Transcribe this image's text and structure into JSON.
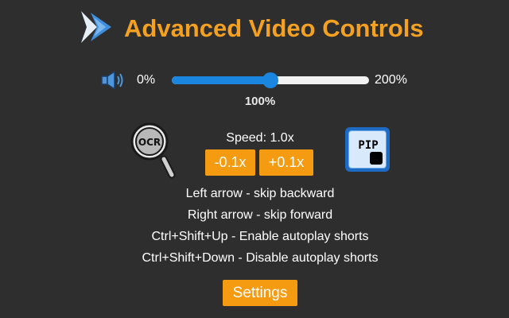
{
  "header": {
    "title": "Advanced Video Controls",
    "logo_icon": "double-chevron-logo-icon",
    "title_color": "#f4a021"
  },
  "volume": {
    "icon": "speaker-icon",
    "min_label": "0%",
    "max_label": "200%",
    "current_label": "100%",
    "value_fraction": 0.5,
    "accent_color": "#1a86e0"
  },
  "ocr": {
    "icon": "ocr-magnifier-icon",
    "label": "OCR"
  },
  "speed": {
    "label": "Speed: 1.0x",
    "decrease_label": "-0.1x",
    "increase_label": "+0.1x"
  },
  "pip": {
    "icon": "pip-icon",
    "label": "PIP"
  },
  "shortcuts": [
    "Left arrow - skip backward",
    "Right arrow - skip forward",
    "Ctrl+Shift+Up - Enable autoplay shorts",
    "Ctrl+Shift+Down - Disable autoplay shorts"
  ],
  "settings": {
    "label": "Settings"
  },
  "colors": {
    "background": "#2e2e2e",
    "button": "#f59b12",
    "text": "#ffffff"
  }
}
